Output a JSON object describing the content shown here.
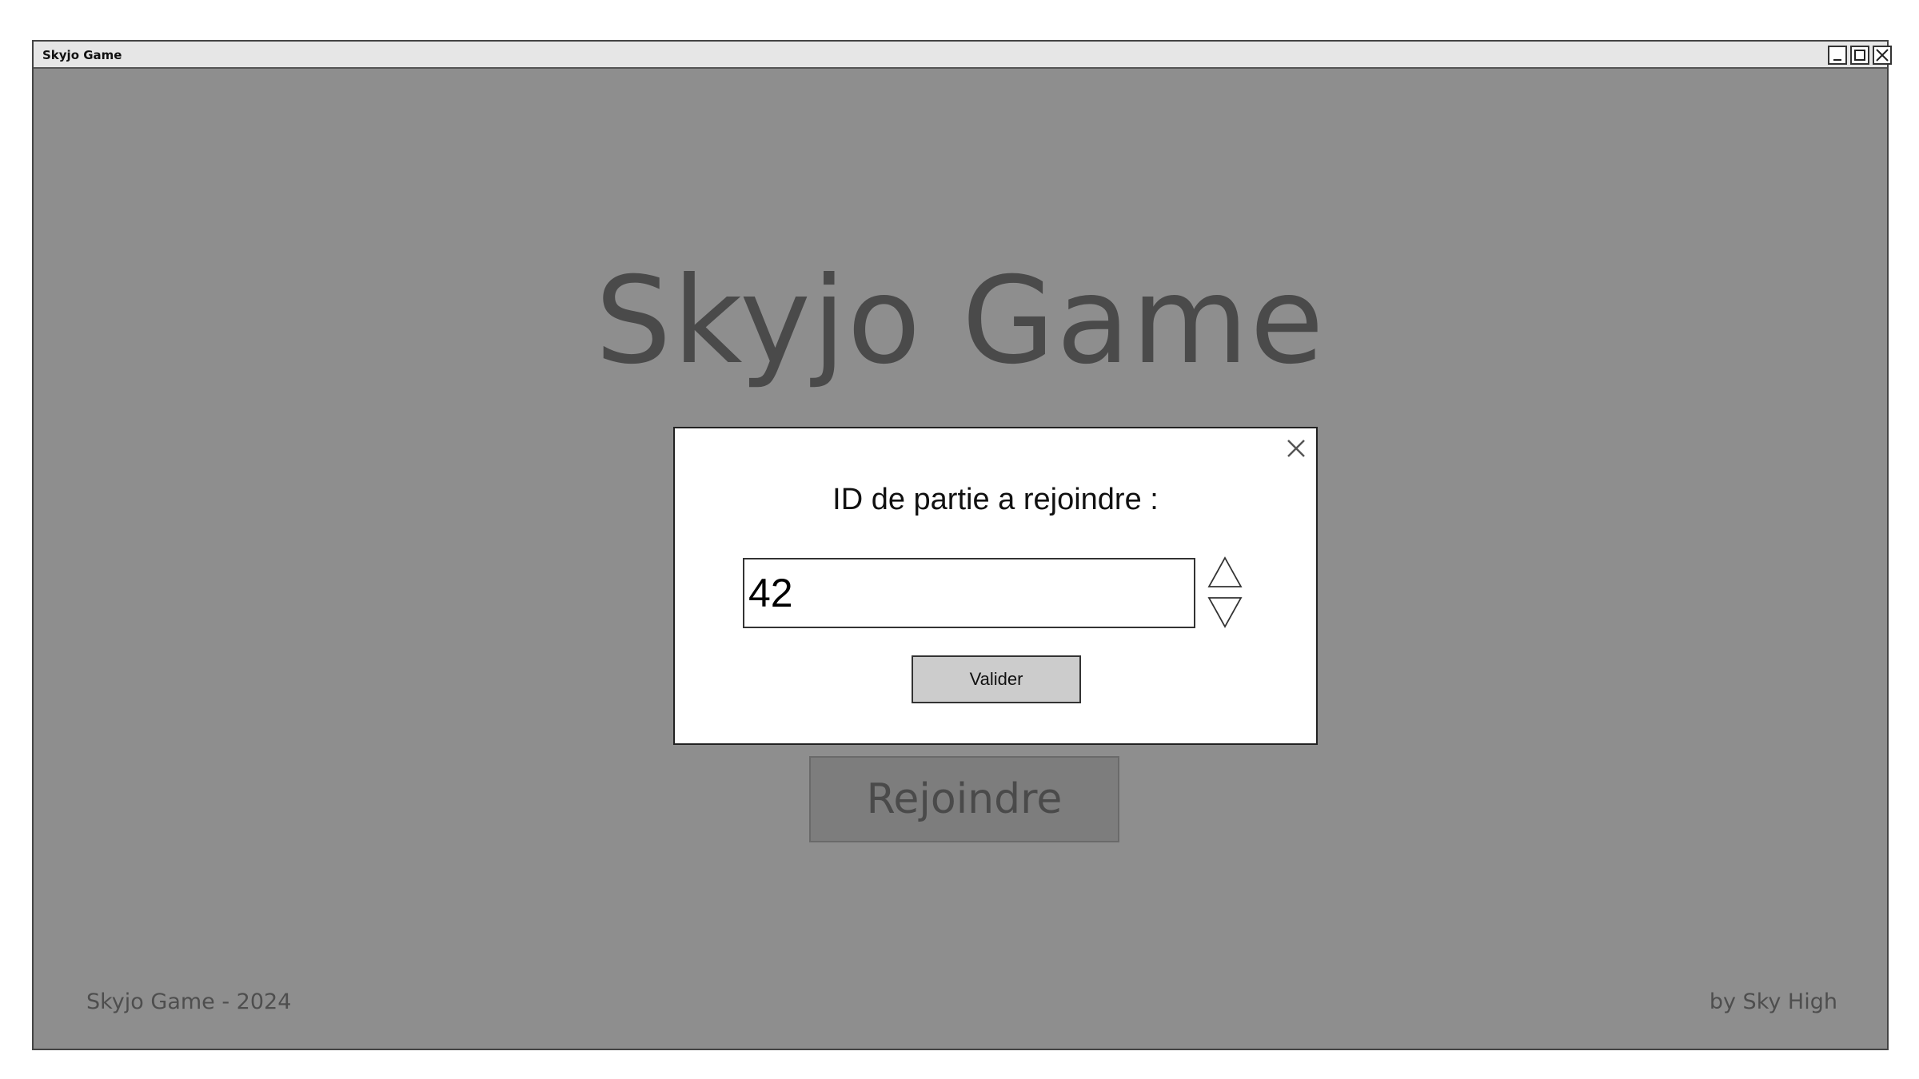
{
  "window": {
    "title": "Skyjo Game",
    "controls": {
      "minimize_icon": "minimize-icon",
      "maximize_icon": "maximize-icon",
      "close_icon": "close-icon"
    }
  },
  "main": {
    "title": "Skyjo Game",
    "join_button_label": "Rejoindre"
  },
  "footer": {
    "left": "Skyjo Game - 2024",
    "right": "by Sky High"
  },
  "modal": {
    "label": "ID de partie a rejoindre :",
    "input_value": "42",
    "validate_label": "Valider",
    "close_icon": "close-icon",
    "spin_up_icon": "triangle-up-icon",
    "spin_down_icon": "triangle-down-icon"
  },
  "colors": {
    "background_overlay": "#8e8e8e",
    "title_text": "#4a4a4a",
    "modal_background": "#ffffff",
    "validate_button": "#cccccc"
  }
}
